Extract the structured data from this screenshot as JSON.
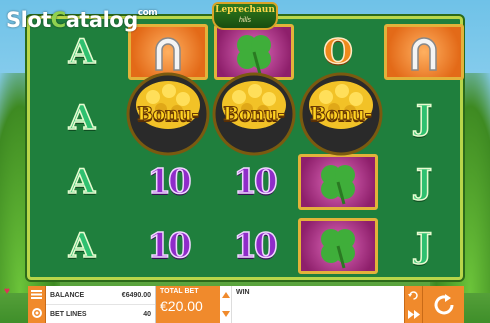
{
  "brand": {
    "name_pre": "Slot",
    "name_c": "C",
    "name_post": "atalog",
    "tm": "com"
  },
  "game": {
    "title_top": "Leprechaun",
    "title_bottom": "hills"
  },
  "reels": {
    "letters": {
      "a": "A",
      "o": "O",
      "j": "J",
      "ten": "10"
    },
    "bonus_label": "Bonu-"
  },
  "controls": {
    "balance_label": "BALANCE",
    "balance_value": "€6490.00",
    "bet_lines_label": "BET LINES",
    "bet_lines_value": "40",
    "total_bet_label": "TOTAL BET",
    "total_bet_value": "€20.00",
    "win_label": "WIN"
  },
  "colors": {
    "accent": "#f08a2c",
    "reel_bg": "#1f7f3d",
    "frame": "#b8d64a"
  },
  "icons": [
    "menu-icon",
    "gear-icon",
    "arrow-up-icon",
    "arrow-down-icon",
    "autoplay-icon",
    "turbo-icon",
    "spin-icon",
    "horseshoe-icon",
    "clover-icon",
    "pot-of-gold-icon"
  ]
}
